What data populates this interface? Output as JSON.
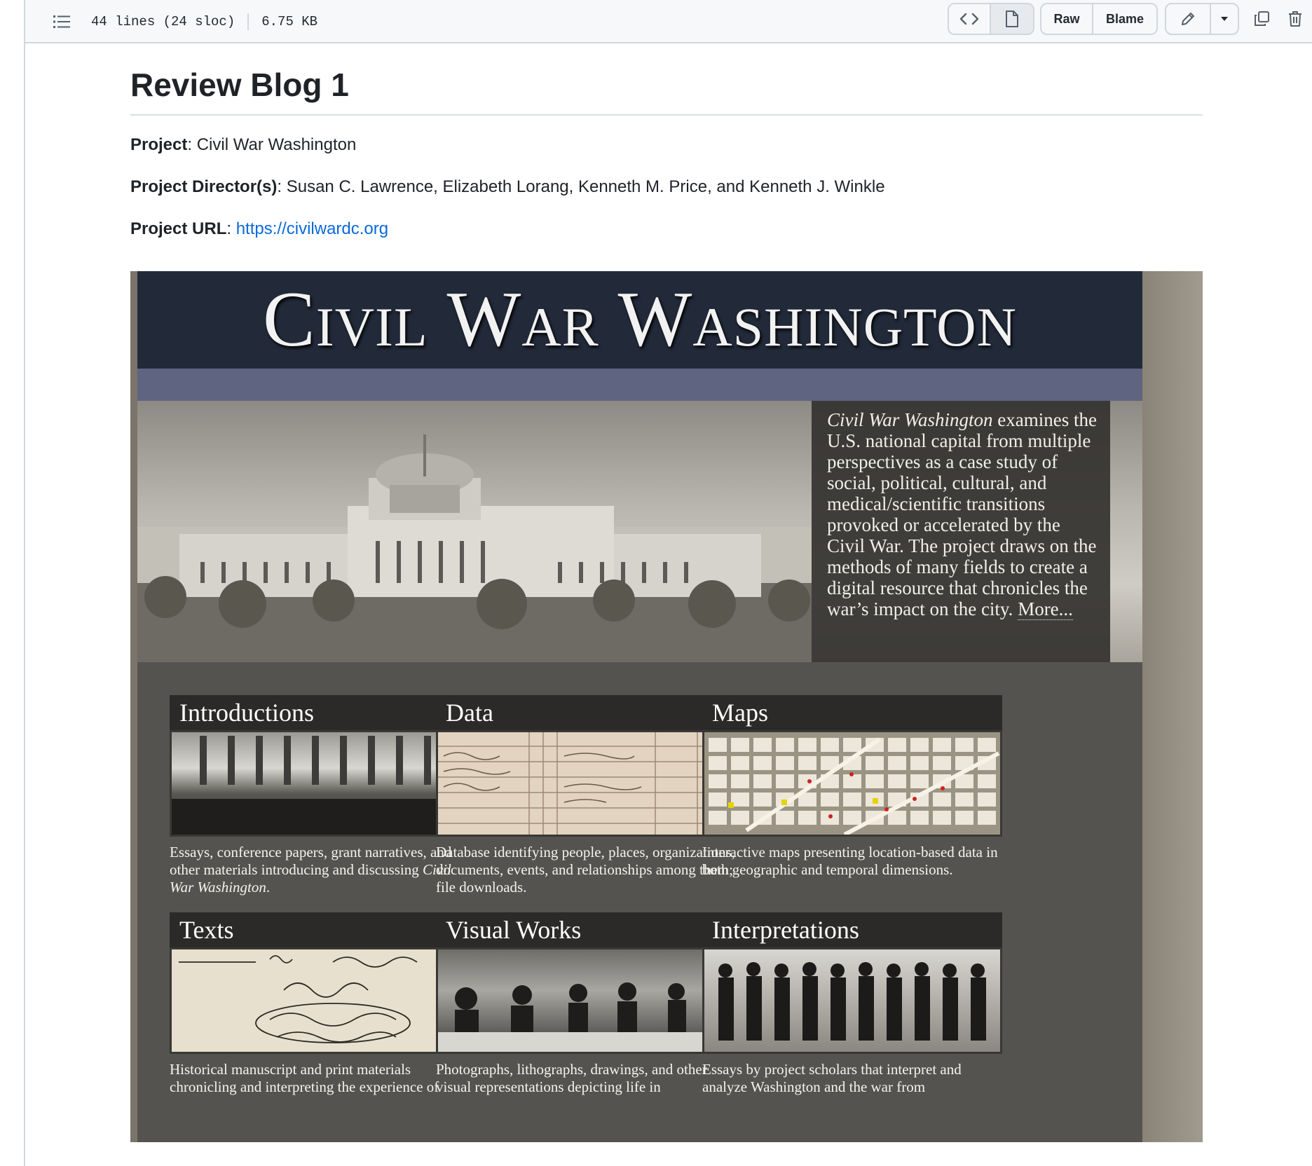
{
  "file_info": {
    "lines": "44 lines (24 sloc)",
    "size": "6.75 KB"
  },
  "toolbar": {
    "raw_label": "Raw",
    "blame_label": "Blame"
  },
  "doc": {
    "title": "Review Blog 1",
    "project_label": "Project",
    "project_value": ": Civil War Washington",
    "directors_label": "Project Director(s)",
    "directors_value": ": Susan C. Lawrence, Elizabeth Lorang, Kenneth M. Price, and Kenneth J. Winkle",
    "url_label": "Project URL",
    "url_sep": ": ",
    "url_value": "https://civilwardc.org"
  },
  "site": {
    "banner_title": "Civil War Washington",
    "intro_italic": "Civil War Washington",
    "intro_text": " examines the U.S. national capital from multiple perspectives as a case study of social, political, cultural, and medical/scientific transitions provoked or accelerated by the Civil War. The project draws on the methods of many fields to create a digital resource that chronicles the war’s impact on the city. ",
    "intro_more": "More...",
    "cards": [
      {
        "title": "Introductions",
        "desc": "Essays, conference papers, grant narratives, and other materials introducing and discussing ",
        "desc_italic": "Civil War Washington",
        "desc_end": "."
      },
      {
        "title": "Data",
        "desc": "Database identifying people, places, organizations, documents, events, and relationships among them; file downloads."
      },
      {
        "title": "Maps",
        "desc": "Interactive maps presenting location-based data in both geographic and temporal dimensions."
      },
      {
        "title": "Texts",
        "desc": "Historical manuscript and print materials chronicling and interpreting the experience of"
      },
      {
        "title": "Visual Works",
        "desc": "Photographs, lithographs, drawings, and other visual representations depicting life in"
      },
      {
        "title": "Interpretations",
        "desc": "Essays by project scholars that interpret and analyze Washington and the war from"
      }
    ]
  }
}
